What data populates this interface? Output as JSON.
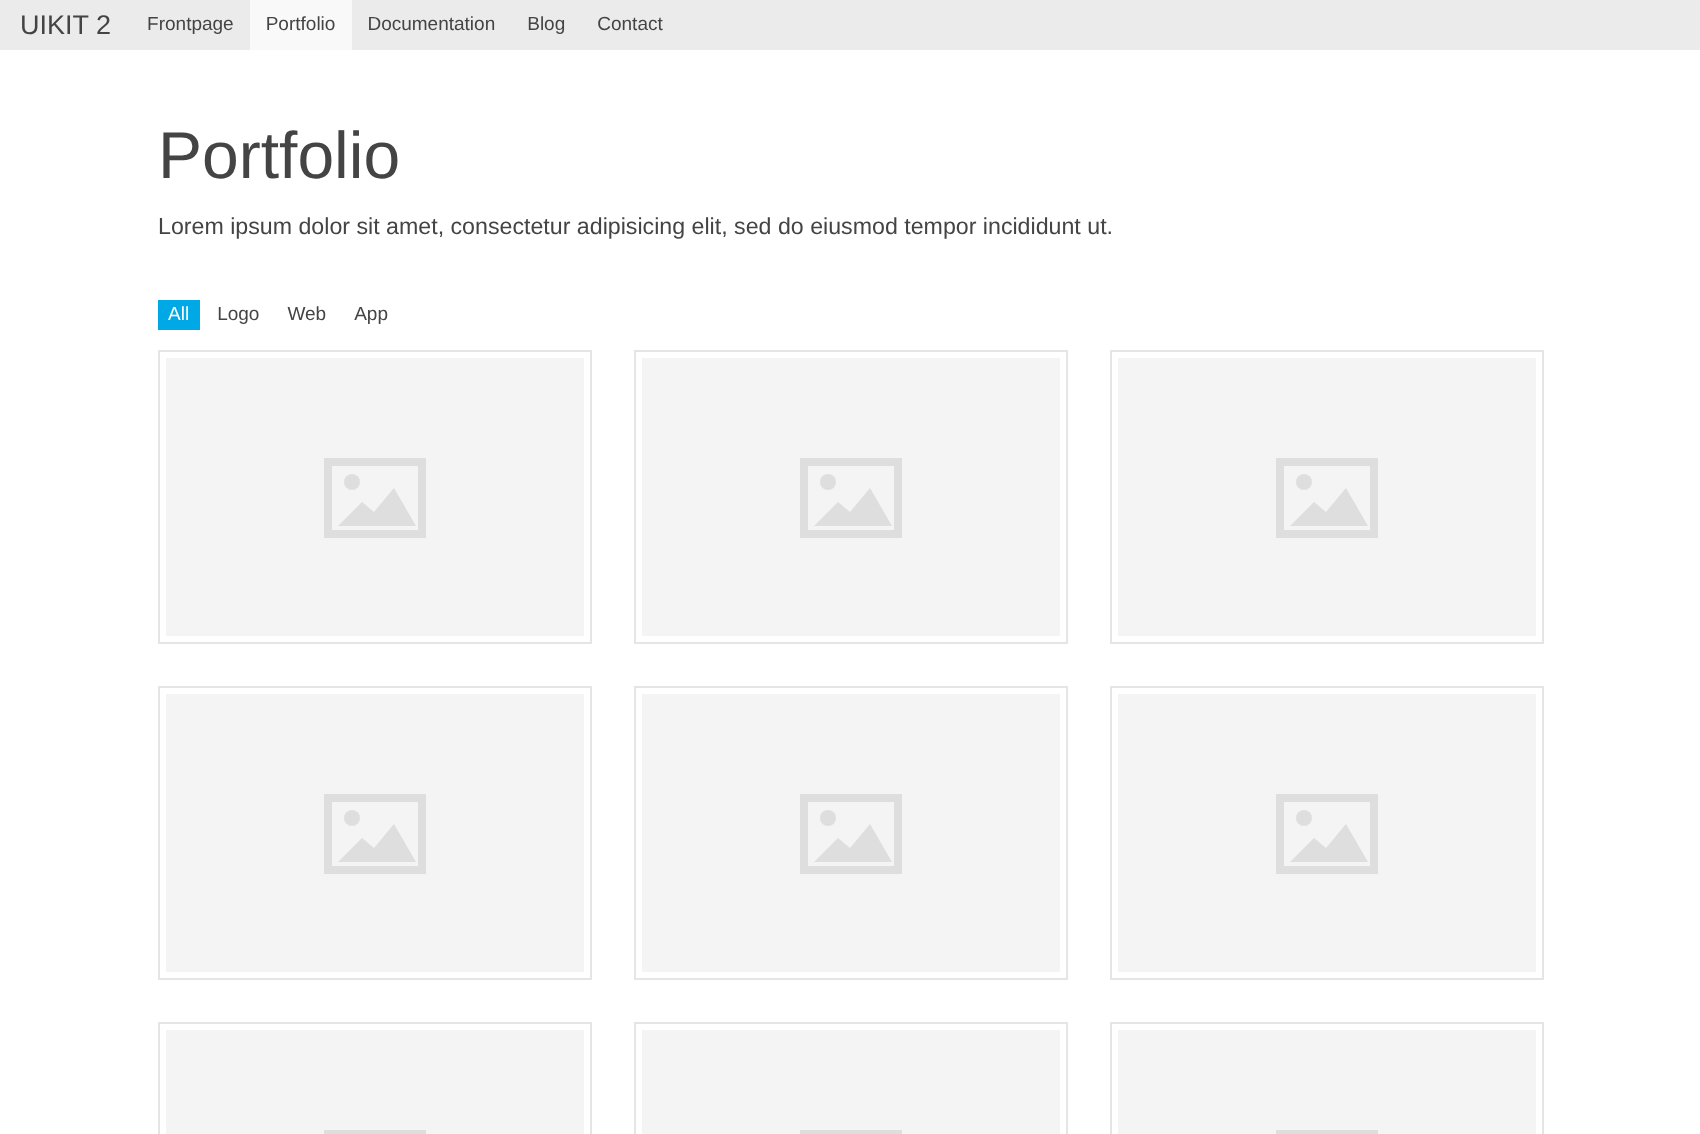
{
  "navbar": {
    "brand": "UIKIT 2",
    "items": [
      {
        "label": "Frontpage",
        "selected": false
      },
      {
        "label": "Portfolio",
        "selected": true
      },
      {
        "label": "Documentation",
        "selected": false
      },
      {
        "label": "Blog",
        "selected": false
      },
      {
        "label": "Contact",
        "selected": false
      }
    ]
  },
  "heading": "Portfolio",
  "lead": "Lorem ipsum dolor sit amet, consectetur adipisicing elit, sed do eiusmod tempor incididunt ut.",
  "filters": [
    {
      "label": "All",
      "selected": true
    },
    {
      "label": "Logo",
      "selected": false
    },
    {
      "label": "Web",
      "selected": false
    },
    {
      "label": "App",
      "selected": false
    }
  ],
  "items": [
    {
      "kind": "placeholder"
    },
    {
      "kind": "placeholder"
    },
    {
      "kind": "placeholder"
    },
    {
      "kind": "placeholder"
    },
    {
      "kind": "placeholder"
    },
    {
      "kind": "placeholder"
    },
    {
      "kind": "placeholder"
    },
    {
      "kind": "placeholder"
    },
    {
      "kind": "placeholder"
    }
  ]
}
